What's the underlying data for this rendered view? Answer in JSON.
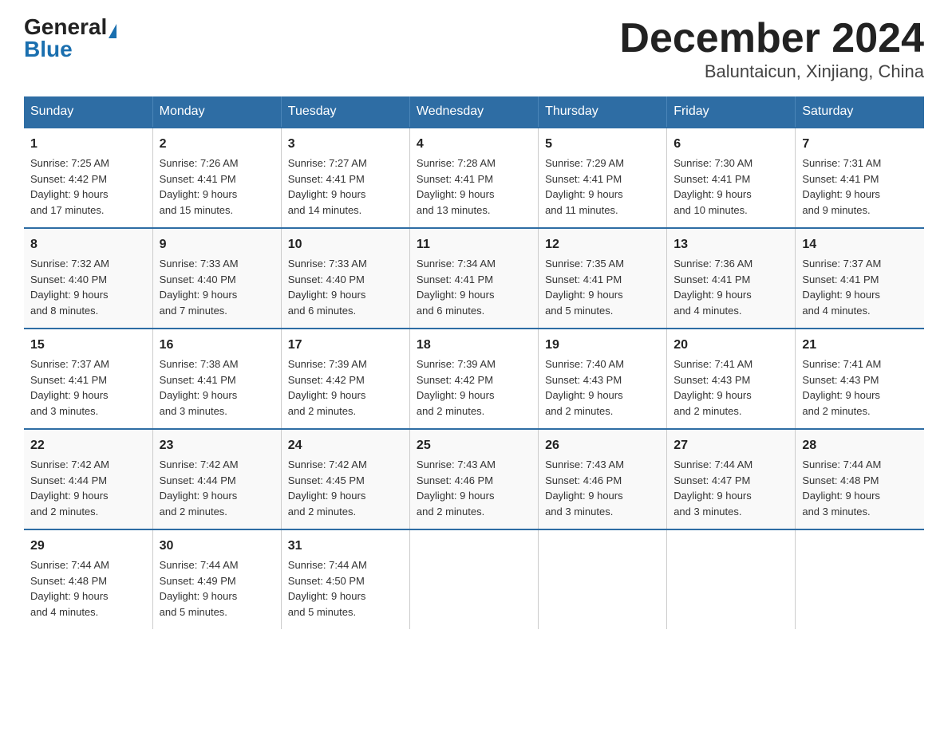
{
  "logo": {
    "general": "General",
    "blue": "Blue"
  },
  "title": "December 2024",
  "subtitle": "Baluntaicun, Xinjiang, China",
  "days_of_week": [
    "Sunday",
    "Monday",
    "Tuesday",
    "Wednesday",
    "Thursday",
    "Friday",
    "Saturday"
  ],
  "weeks": [
    [
      {
        "day": "1",
        "sunrise": "7:25 AM",
        "sunset": "4:42 PM",
        "daylight": "9 hours and 17 minutes."
      },
      {
        "day": "2",
        "sunrise": "7:26 AM",
        "sunset": "4:41 PM",
        "daylight": "9 hours and 15 minutes."
      },
      {
        "day": "3",
        "sunrise": "7:27 AM",
        "sunset": "4:41 PM",
        "daylight": "9 hours and 14 minutes."
      },
      {
        "day": "4",
        "sunrise": "7:28 AM",
        "sunset": "4:41 PM",
        "daylight": "9 hours and 13 minutes."
      },
      {
        "day": "5",
        "sunrise": "7:29 AM",
        "sunset": "4:41 PM",
        "daylight": "9 hours and 11 minutes."
      },
      {
        "day": "6",
        "sunrise": "7:30 AM",
        "sunset": "4:41 PM",
        "daylight": "9 hours and 10 minutes."
      },
      {
        "day": "7",
        "sunrise": "7:31 AM",
        "sunset": "4:41 PM",
        "daylight": "9 hours and 9 minutes."
      }
    ],
    [
      {
        "day": "8",
        "sunrise": "7:32 AM",
        "sunset": "4:40 PM",
        "daylight": "9 hours and 8 minutes."
      },
      {
        "day": "9",
        "sunrise": "7:33 AM",
        "sunset": "4:40 PM",
        "daylight": "9 hours and 7 minutes."
      },
      {
        "day": "10",
        "sunrise": "7:33 AM",
        "sunset": "4:40 PM",
        "daylight": "9 hours and 6 minutes."
      },
      {
        "day": "11",
        "sunrise": "7:34 AM",
        "sunset": "4:41 PM",
        "daylight": "9 hours and 6 minutes."
      },
      {
        "day": "12",
        "sunrise": "7:35 AM",
        "sunset": "4:41 PM",
        "daylight": "9 hours and 5 minutes."
      },
      {
        "day": "13",
        "sunrise": "7:36 AM",
        "sunset": "4:41 PM",
        "daylight": "9 hours and 4 minutes."
      },
      {
        "day": "14",
        "sunrise": "7:37 AM",
        "sunset": "4:41 PM",
        "daylight": "9 hours and 4 minutes."
      }
    ],
    [
      {
        "day": "15",
        "sunrise": "7:37 AM",
        "sunset": "4:41 PM",
        "daylight": "9 hours and 3 minutes."
      },
      {
        "day": "16",
        "sunrise": "7:38 AM",
        "sunset": "4:41 PM",
        "daylight": "9 hours and 3 minutes."
      },
      {
        "day": "17",
        "sunrise": "7:39 AM",
        "sunset": "4:42 PM",
        "daylight": "9 hours and 2 minutes."
      },
      {
        "day": "18",
        "sunrise": "7:39 AM",
        "sunset": "4:42 PM",
        "daylight": "9 hours and 2 minutes."
      },
      {
        "day": "19",
        "sunrise": "7:40 AM",
        "sunset": "4:43 PM",
        "daylight": "9 hours and 2 minutes."
      },
      {
        "day": "20",
        "sunrise": "7:41 AM",
        "sunset": "4:43 PM",
        "daylight": "9 hours and 2 minutes."
      },
      {
        "day": "21",
        "sunrise": "7:41 AM",
        "sunset": "4:43 PM",
        "daylight": "9 hours and 2 minutes."
      }
    ],
    [
      {
        "day": "22",
        "sunrise": "7:42 AM",
        "sunset": "4:44 PM",
        "daylight": "9 hours and 2 minutes."
      },
      {
        "day": "23",
        "sunrise": "7:42 AM",
        "sunset": "4:44 PM",
        "daylight": "9 hours and 2 minutes."
      },
      {
        "day": "24",
        "sunrise": "7:42 AM",
        "sunset": "4:45 PM",
        "daylight": "9 hours and 2 minutes."
      },
      {
        "day": "25",
        "sunrise": "7:43 AM",
        "sunset": "4:46 PM",
        "daylight": "9 hours and 2 minutes."
      },
      {
        "day": "26",
        "sunrise": "7:43 AM",
        "sunset": "4:46 PM",
        "daylight": "9 hours and 3 minutes."
      },
      {
        "day": "27",
        "sunrise": "7:44 AM",
        "sunset": "4:47 PM",
        "daylight": "9 hours and 3 minutes."
      },
      {
        "day": "28",
        "sunrise": "7:44 AM",
        "sunset": "4:48 PM",
        "daylight": "9 hours and 3 minutes."
      }
    ],
    [
      {
        "day": "29",
        "sunrise": "7:44 AM",
        "sunset": "4:48 PM",
        "daylight": "9 hours and 4 minutes."
      },
      {
        "day": "30",
        "sunrise": "7:44 AM",
        "sunset": "4:49 PM",
        "daylight": "9 hours and 5 minutes."
      },
      {
        "day": "31",
        "sunrise": "7:44 AM",
        "sunset": "4:50 PM",
        "daylight": "9 hours and 5 minutes."
      },
      null,
      null,
      null,
      null
    ]
  ],
  "cell_labels": {
    "sunrise": "Sunrise: ",
    "sunset": "Sunset: ",
    "daylight": "Daylight: "
  }
}
